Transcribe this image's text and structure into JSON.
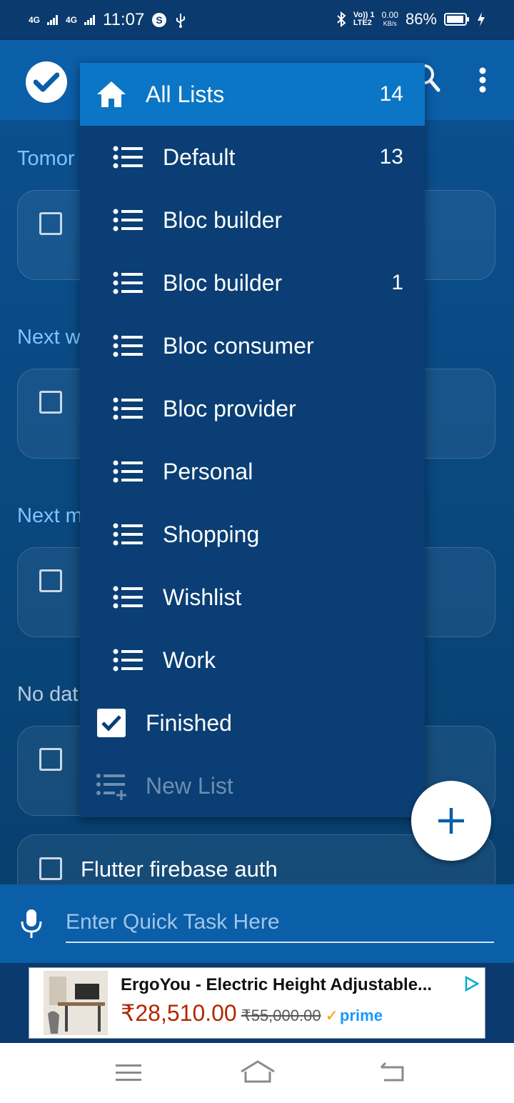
{
  "status_bar": {
    "network1": "4G",
    "network2": "4G",
    "time": "11:07",
    "volte_line1": "Vo)) 1",
    "volte_line2": "LTE2",
    "speed_value": "0.00",
    "speed_unit": "KB/s",
    "battery": "86%"
  },
  "sections": {
    "tomorrow": "Tomor",
    "next_week": "Next w",
    "next_month": "Next m",
    "no_date": "No dat"
  },
  "tasks": [
    {
      "title": "Flutter firebase auth"
    }
  ],
  "list_menu": {
    "all_lists": {
      "label": "All Lists",
      "count": "14"
    },
    "items": [
      {
        "label": "Default",
        "count": "13"
      },
      {
        "label": "Bloc builder",
        "count": ""
      },
      {
        "label": "Bloc builder",
        "count": "1"
      },
      {
        "label": "Bloc consumer",
        "count": ""
      },
      {
        "label": "Bloc provider",
        "count": ""
      },
      {
        "label": "Personal",
        "count": ""
      },
      {
        "label": "Shopping",
        "count": ""
      },
      {
        "label": "Wishlist",
        "count": ""
      },
      {
        "label": "Work",
        "count": ""
      }
    ],
    "finished": "Finished",
    "new_list": "New List"
  },
  "quick_task": {
    "placeholder": "Enter Quick Task Here"
  },
  "ad": {
    "title": "ErgoYou - Electric Height Adjustable...",
    "price": "₹28,510.00",
    "original_price": "₹55,000.00",
    "badge": "prime"
  },
  "colors": {
    "appbar": "#0b5ea8",
    "background": "#0a3a6e",
    "menu": "#0a3e74",
    "menu_active": "#0b76c5",
    "accent_text": "#7fc4ff",
    "ad_price": "#b12704"
  }
}
